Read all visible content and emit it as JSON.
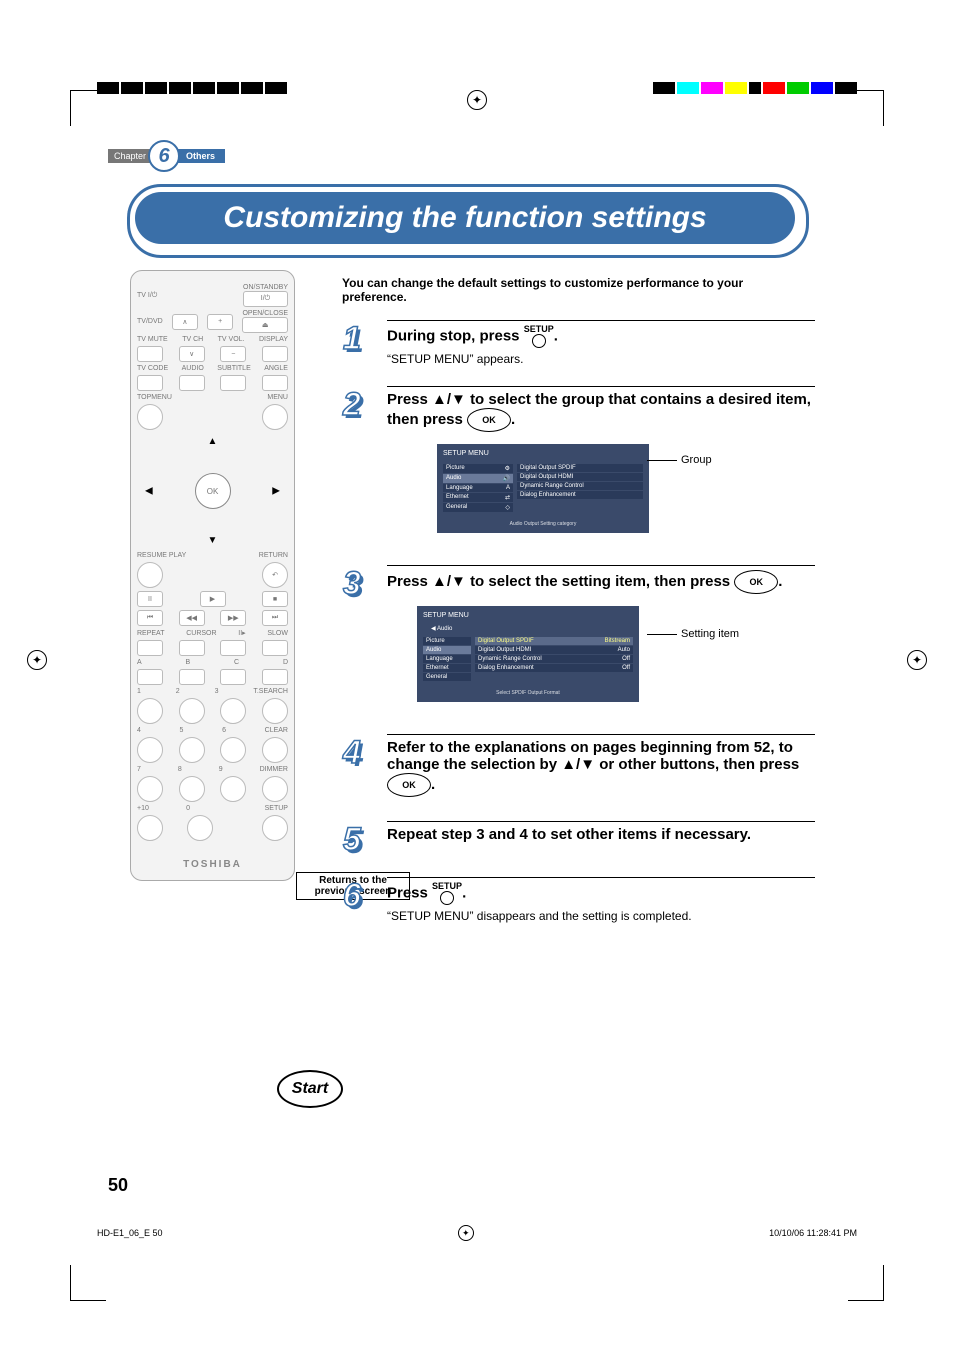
{
  "chapter": {
    "label": "Chapter",
    "number": "6",
    "section": "Others"
  },
  "title": "Customizing the function settings",
  "intro": "You can change the default settings to customize performance to your preference.",
  "remote": {
    "labels": {
      "tv_power": "TV  I/⏻",
      "onstandby": "ON/STANDBY",
      "power": "I/⏻",
      "tvdvd": "TV/DVD",
      "openclose": "OPEN/CLOSE",
      "eject": "⏏",
      "tvmute": "TV MUTE",
      "tvch": "TV CH",
      "tvvol": "TV VOL.",
      "display": "DISPLAY",
      "tvcode": "TV CODE",
      "audio": "AUDIO",
      "subtitle": "SUBTITLE",
      "angle": "ANGLE",
      "topmenu": "TOPMENU",
      "menu": "MENU",
      "ok": "OK",
      "up": "▲",
      "down": "▼",
      "left": "◀",
      "right": "▶",
      "resume": "RESUME PLAY",
      "return": "RETURN",
      "pause": "II",
      "repeat": "REPEAT",
      "cursor": "CURSOR",
      "step": "II▸",
      "slow": "SLOW",
      "a": "A",
      "b": "B",
      "c": "C",
      "d": "D",
      "1": "1",
      "2": "2",
      "3": "3",
      "tsearch": "T.SEARCH",
      "4": "4",
      "5": "5",
      "6": "6",
      "clear": "CLEAR",
      "7": "7",
      "8": "8",
      "9": "9",
      "dimmer": "DIMMER",
      "plus10": "+10",
      "0": "0",
      "setup": "SETUP",
      "brand": "TOSHIBA"
    },
    "callouts": {
      "returns": "Returns to the previous screen",
      "start": "Start"
    }
  },
  "steps": {
    "s1": {
      "n": "1",
      "head_a": "During stop, press ",
      "head_b": ".",
      "setup_label": "SETUP",
      "sub": "“SETUP MENU” appears."
    },
    "s2": {
      "n": "2",
      "head_a": "Press ▲/▼ to select the group that contains a desired item, then press ",
      "ok": "OK",
      "head_b": ".",
      "label_group": "Group",
      "menu": {
        "title": "SETUP MENU",
        "left": [
          "Picture",
          "Audio",
          "Language",
          "Ethernet",
          "General"
        ],
        "left_sel_idx": 1,
        "right": [
          "Digital Output SPDIF",
          "Digital Output HDMI",
          "Dynamic Range Control",
          "Dialog Enhancement"
        ],
        "hint": "Audio Output Setting category"
      }
    },
    "s3": {
      "n": "3",
      "head_a": "Press ▲/▼ to select the setting item, then press ",
      "ok": "OK",
      "head_b": ".",
      "label_item": "Setting item",
      "menu": {
        "title": "SETUP MENU",
        "crumb": "Audio",
        "left": [
          "Picture",
          "Audio",
          "Language",
          "Ethernet",
          "General"
        ],
        "left_sel_idx": 1,
        "right": [
          {
            "k": "Digital Output SPDIF",
            "v": "Bitstream",
            "sel": true
          },
          {
            "k": "Digital Output HDMI",
            "v": "Auto"
          },
          {
            "k": "Dynamic Range Control",
            "v": "Off"
          },
          {
            "k": "Dialog Enhancement",
            "v": "Off"
          }
        ],
        "hint": "Select SPDIF Output Format"
      }
    },
    "s4": {
      "n": "4",
      "head_a": "Refer to the explanations on pages beginning from 52, to change the selection by ▲/▼ or other buttons, then press ",
      "ok": "OK",
      "head_b": "."
    },
    "s5": {
      "n": "5",
      "head": "Repeat step 3 and 4 to set other items if necessary."
    },
    "s6": {
      "n": "6",
      "head_a": "Press ",
      "head_b": ".",
      "setup_label": "SETUP",
      "sub": "“SETUP MENU” disappears and the setting is completed."
    }
  },
  "page_number": "50",
  "footer": {
    "left": "HD-E1_06_E   50",
    "right": "10/10/06   11:28:41 PM"
  }
}
